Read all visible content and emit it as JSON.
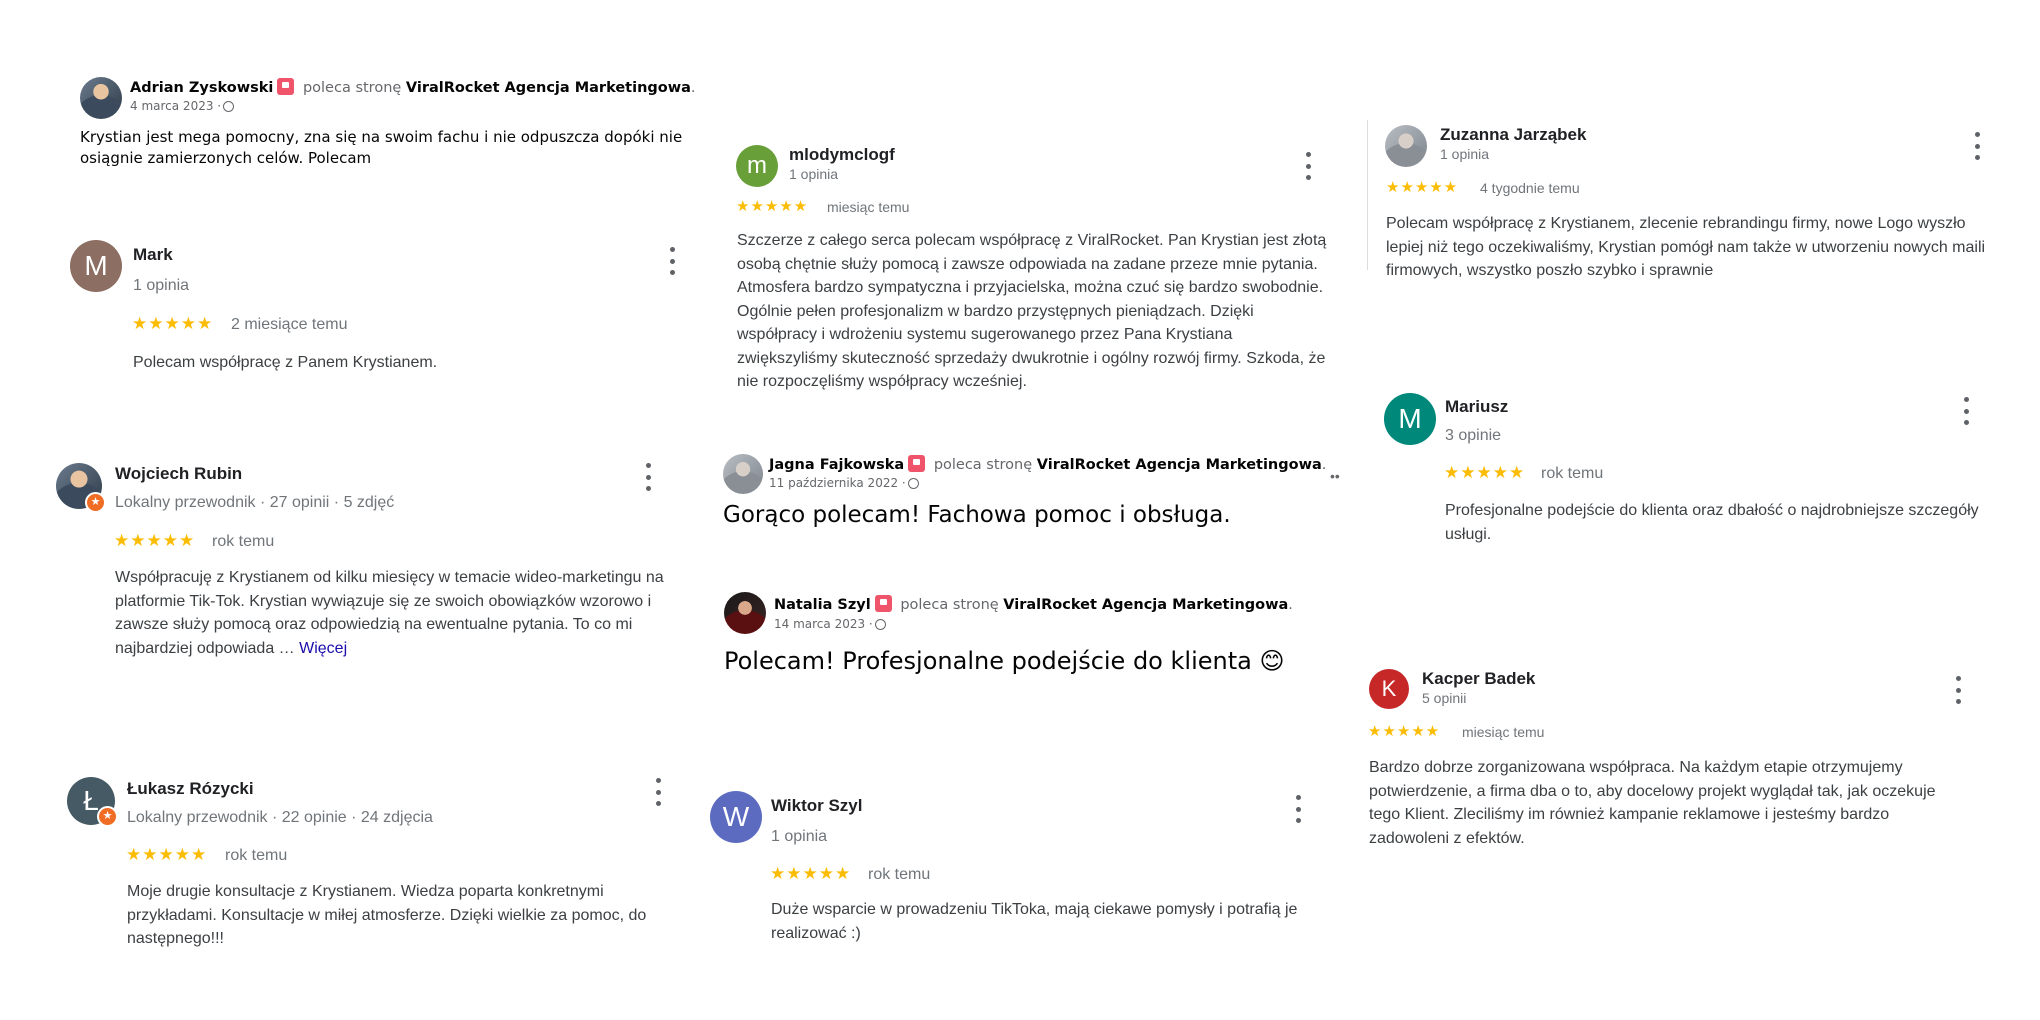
{
  "colors": {
    "star": "#fbbc04",
    "fb_badge": "#f0546a",
    "link": "#1a0dab"
  },
  "fb_reviews": [
    {
      "name": "Adrian Zyskowski",
      "action": "poleca stronę",
      "page": "ViralRocket Agencja Marketingowa",
      "date": "4 marca 2023 ·",
      "text": "Krystian jest mega pomocny, zna się na swoim fachu i nie odpuszcza dopóki nie osiągnie zamierzonych celów. Polecam"
    },
    {
      "name": "Jagna Fajkowska",
      "action": "poleca stronę",
      "page": "ViralRocket Agencja Marketingowa",
      "date": "11 października 2022 ·",
      "text": "Gorąco polecam! Fachowa pomoc i obsługa."
    },
    {
      "name": "Natalia Szyl",
      "action": "poleca stronę",
      "page": "ViralRocket Agencja Marketingowa",
      "date": "14 marca 2023 ·",
      "text": "Polecam! Profesjonalne podejście do klienta 😊"
    }
  ],
  "g_reviews": [
    {
      "initial": "M",
      "name": "Mark",
      "meta": "1 opinia",
      "stars": "★★★★★",
      "when": "2 miesiące temu",
      "text": "Polecam współpracę z Panem Krystianem."
    },
    {
      "initial": "",
      "name": "Wojciech Rubin",
      "meta": "Lokalny przewodnik · 27 opinii · 5 zdjęć",
      "stars": "★★★★★",
      "when": "rok temu",
      "text": "Współpracuję z Krystianem od kilku miesięcy w temacie wideo-marketingu na platformie Tik-Tok. Krystian wywiązuje się ze swoich obowiązków wzorowo i zawsze służy pomocą oraz odpowiedzią na ewentualne pytania. To co mi najbardziej odpowiada …",
      "more": "Więcej"
    },
    {
      "initial": "Ł",
      "name": "Łukasz Rózycki",
      "meta": "Lokalny przewodnik · 22 opinie · 24 zdjęcia",
      "stars": "★★★★★",
      "when": "rok temu",
      "text": "Moje drugie konsultacje z Krystianem. Wiedza poparta konkretnymi przykładami. Konsultacje w miłej atmosferze. Dzięki wielkie za pomoc, do następnego!!!"
    },
    {
      "initial": "m",
      "name": "mlodymclogf",
      "meta": "1 opinia",
      "stars": "★★★★★",
      "when": "miesiąc temu",
      "text": "Szczerze z całego serca polecam współpracę z ViralRocket. Pan Krystian jest złotą osobą chętnie służy pomocą i zawsze odpowiada na zadane przeze mnie pytania. Atmosfera bardzo sympatyczna i przyjacielska, można czuć się bardzo swobodnie. Ogólnie pełen profesjonalizm w bardzo przystępnych pieniądzach. Dzięki współpracy i wdrożeniu systemu sugerowanego przez Pana Krystiana zwiększyliśmy skuteczność sprzedaży dwukrotnie i ogólny rozwój firmy. Szkoda, że nie rozpoczęliśmy współpracy wcześniej."
    },
    {
      "initial": "W",
      "name": "Wiktor Szyl",
      "meta": "1 opinia",
      "stars": "★★★★★",
      "when": "rok temu",
      "text": "Duże wsparcie w prowadzeniu TikToka, mają ciekawe pomysły i potrafią je realizować :)"
    },
    {
      "initial": "",
      "name": "Zuzanna Jarząbek",
      "meta": "1 opinia",
      "stars": "★★★★★",
      "when": "4 tygodnie temu",
      "text": "Polecam współpracę z Krystianem, zlecenie rebrandingu firmy, nowe Logo wyszło lepiej niż tego oczekiwaliśmy, Krystian pomógł nam także w utworzeniu nowych maili firmowych, wszystko poszło szybko i sprawnie"
    },
    {
      "initial": "M",
      "name": "Mariusz",
      "meta": "3 opinie",
      "stars": "★★★★★",
      "when": "rok temu",
      "text": "Profesjonalne podejście do klienta oraz dbałość o najdrobniejsze szczegóły usługi."
    },
    {
      "initial": "K",
      "name": "Kacper Badek",
      "meta": "5 opinii",
      "stars": "★★★★★",
      "when": "miesiąc temu",
      "text": "Bardzo dobrze zorganizowana współpraca. Na każdym etapie otrzymujemy potwierdzenie, a firma dba o to, aby docelowy projekt wyglądał tak, jak oczekuje tego Klient. Zleciliśmy im również kampanie reklamowe i jesteśmy bardzo zadowoleni z efektów."
    }
  ]
}
